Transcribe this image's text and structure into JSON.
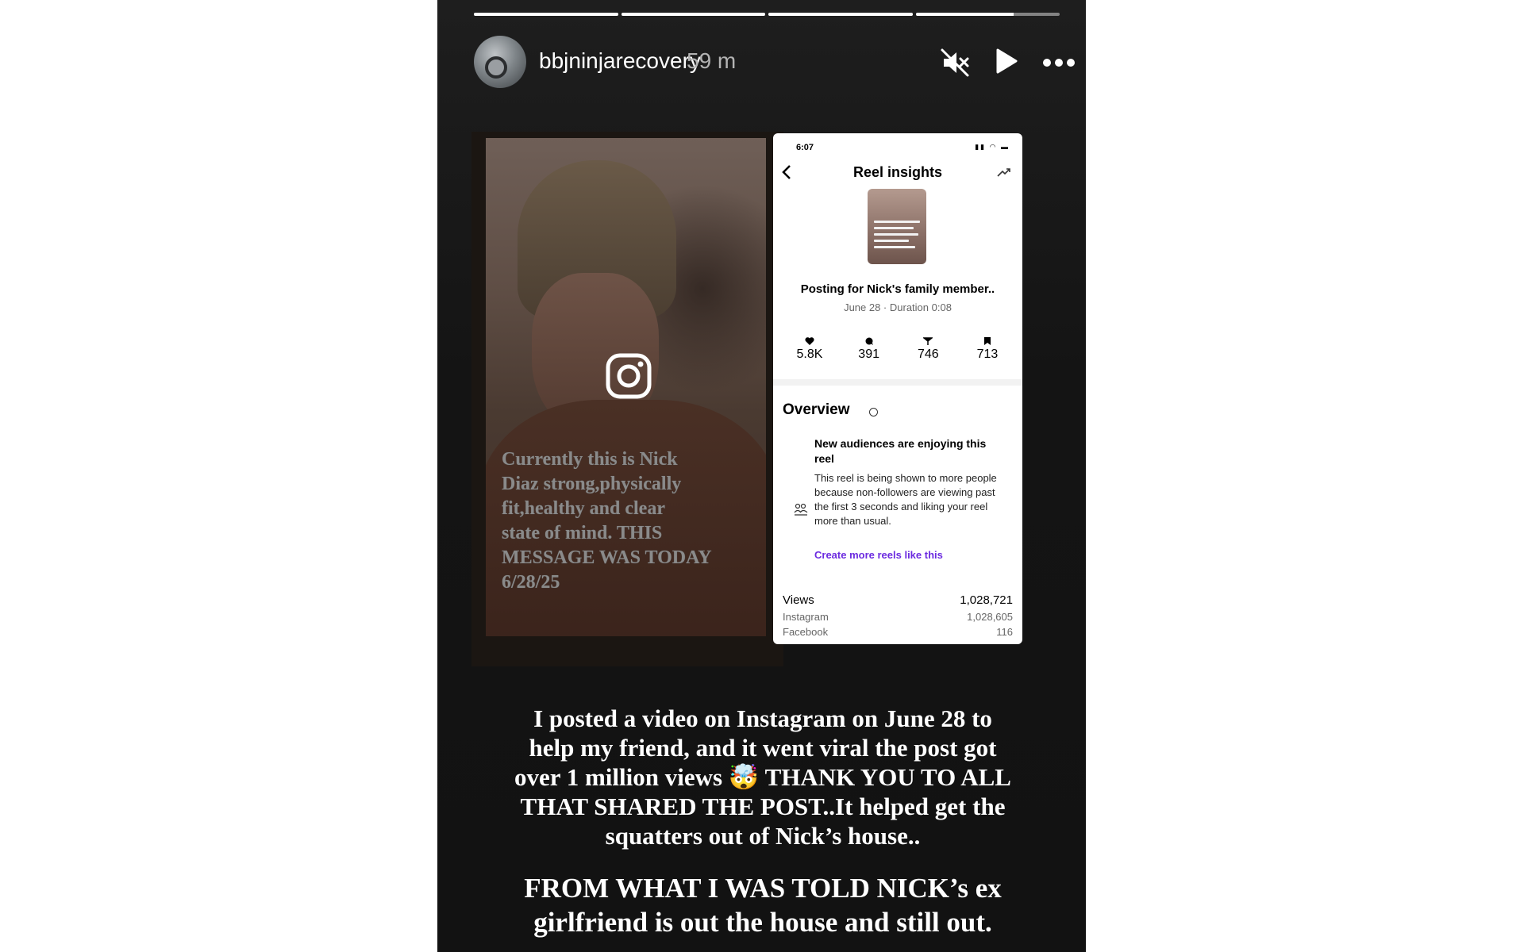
{
  "story": {
    "progress": [
      1,
      1,
      1,
      0.68
    ],
    "username": "bbjninjarecovery",
    "time_ago": "59 m",
    "icons": {
      "mute": "speaker-muted-icon",
      "play": "play-icon",
      "more": "more-dots-icon"
    }
  },
  "video": {
    "caption": "Currently this is Nick\nDiaz  strong,physically\nfit,healthy and clear\nstate of mind. THIS\nMESSAGE WAS TODAY\n6/28/25",
    "icon": "instagram-icon"
  },
  "insights": {
    "status_time": "6:07",
    "title": "Reel insights",
    "post_title": "Posting for  Nick's family member..",
    "post_meta": "June 28 · Duration 0:08",
    "stats": [
      {
        "icon": "heart-icon",
        "value": "5.8K"
      },
      {
        "icon": "comment-icon",
        "value": "391"
      },
      {
        "icon": "share-icon",
        "value": "746"
      },
      {
        "icon": "bookmark-icon",
        "value": "713"
      }
    ],
    "overview": "Overview",
    "audience_title": "New audiences are enjoying this reel",
    "audience_body": "This reel is being shown to more people because non-followers are viewing past the first 3 seconds and liking your reel more than usual.",
    "audience_link": "Create more reels like this",
    "views": [
      {
        "label": "Views",
        "value": "1,028,721"
      },
      {
        "label": "Instagram",
        "value": "1,028,605"
      },
      {
        "label": "Facebook",
        "value": "116"
      }
    ]
  },
  "text": {
    "paragraph1": "I posted a video on Instagram on June 28 to\nhelp my friend, and it went viral the post got\nover 1 million views 🤯 THANK YOU TO ALL\nTHAT SHARED THE POST..It helped get the\nsquatters out of Nick’s house..",
    "paragraph2": "FROM WHAT I WAS TOLD NICK’s ex\ngirlfriend is out the house  and still out."
  }
}
